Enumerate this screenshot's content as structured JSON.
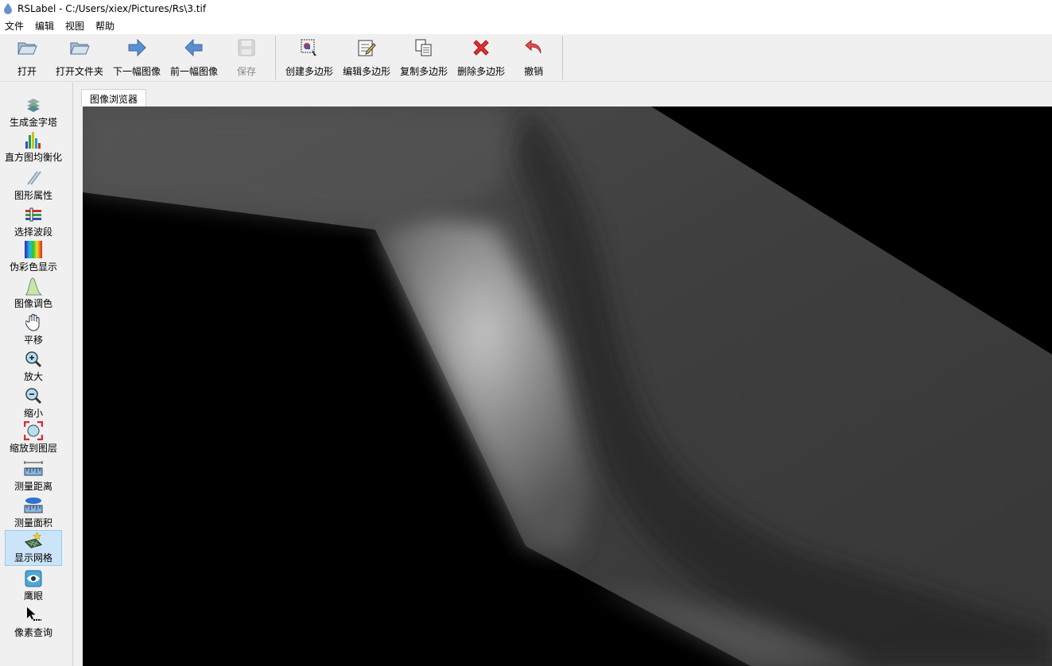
{
  "window": {
    "title": "RSLabel - C:/Users/xiex/Pictures/Rs\\3.tif",
    "app_icon": "droplet-icon"
  },
  "menu": [
    "文件",
    "编辑",
    "视图",
    "帮助"
  ],
  "toolbar": {
    "open": {
      "label": "打开",
      "icon": "folder-open-icon"
    },
    "open_folder": {
      "label": "打开文件夹",
      "icon": "folder-open-icon"
    },
    "next_image": {
      "label": "下一幅图像",
      "icon": "arrow-right-icon"
    },
    "prev_image": {
      "label": "前一幅图像",
      "icon": "arrow-left-icon"
    },
    "save": {
      "label": "保存",
      "icon": "floppy-disk-icon",
      "enabled": false
    },
    "create_polygon": {
      "label": "创建多边形",
      "icon": "create-polygon-icon"
    },
    "edit_polygon": {
      "label": "编辑多边形",
      "icon": "edit-note-icon"
    },
    "copy_polygon": {
      "label": "复制多边形",
      "icon": "copy-icon"
    },
    "delete_polygon": {
      "label": "删除多边形",
      "icon": "red-x-icon"
    },
    "undo": {
      "label": "撤销",
      "icon": "undo-arrow-icon"
    }
  },
  "sidebar": {
    "pyramid": "生成金字塔",
    "histogram": "直方图均衡化",
    "shape_props": "图形属性",
    "select_band": "选择波段",
    "pseudo_color": "伪彩色显示",
    "image_tone": "图像调色",
    "pan": "平移",
    "zoom_in": "放大",
    "zoom_out": "缩小",
    "zoom_layer": "缩放到图层",
    "measure_distance": "测量距离",
    "measure_area": "测量面积",
    "show_grid": "显示网格",
    "eagle_eye": "鹰眼",
    "pixel_query": "像素查询"
  },
  "tabs": {
    "image_browser": "图像浏览器"
  },
  "colors": {
    "accent_active": "#cce4f7",
    "arrow_blue": "#4a7fc0",
    "delete_red": "#e03030"
  }
}
